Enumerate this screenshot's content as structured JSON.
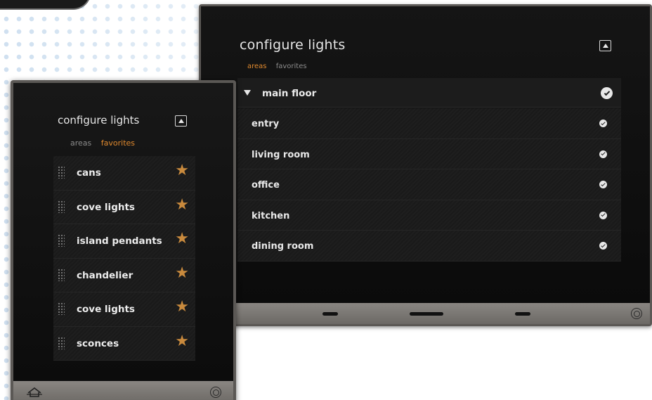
{
  "colors": {
    "accent": "#e0892e",
    "star": "#c98a3d",
    "screen_bg": "#111111",
    "bezel": "#5b5855"
  },
  "landscape": {
    "title": "configure lights",
    "tabs": [
      {
        "label": "areas",
        "active": true
      },
      {
        "label": "favorites",
        "active": false
      }
    ],
    "collapse_icon": "triangle-up-icon",
    "group": {
      "label": "main floor",
      "expanded": true,
      "checked": true
    },
    "areas": [
      {
        "label": "entry",
        "checked": true
      },
      {
        "label": "living room",
        "checked": true
      },
      {
        "label": "office",
        "checked": true
      },
      {
        "label": "kitchen",
        "checked": true
      },
      {
        "label": "dining room",
        "checked": true
      }
    ],
    "bottom_bar": {
      "right_icon": "home-button-icon"
    }
  },
  "portrait": {
    "title": "configure lights",
    "tabs": [
      {
        "label": "areas",
        "active": false
      },
      {
        "label": "favorites",
        "active": true
      }
    ],
    "collapse_icon": "triangle-up-icon",
    "favorites": [
      {
        "label": "cans",
        "favorite": true
      },
      {
        "label": "cove lights",
        "favorite": true
      },
      {
        "label": "island pendants",
        "favorite": true
      },
      {
        "label": "chandelier",
        "favorite": true
      },
      {
        "label": "cove lights",
        "favorite": true
      },
      {
        "label": "sconces",
        "favorite": true
      }
    ],
    "bottom_bar": {
      "left_icon": "house-icon",
      "right_icon": "home-button-icon"
    }
  }
}
